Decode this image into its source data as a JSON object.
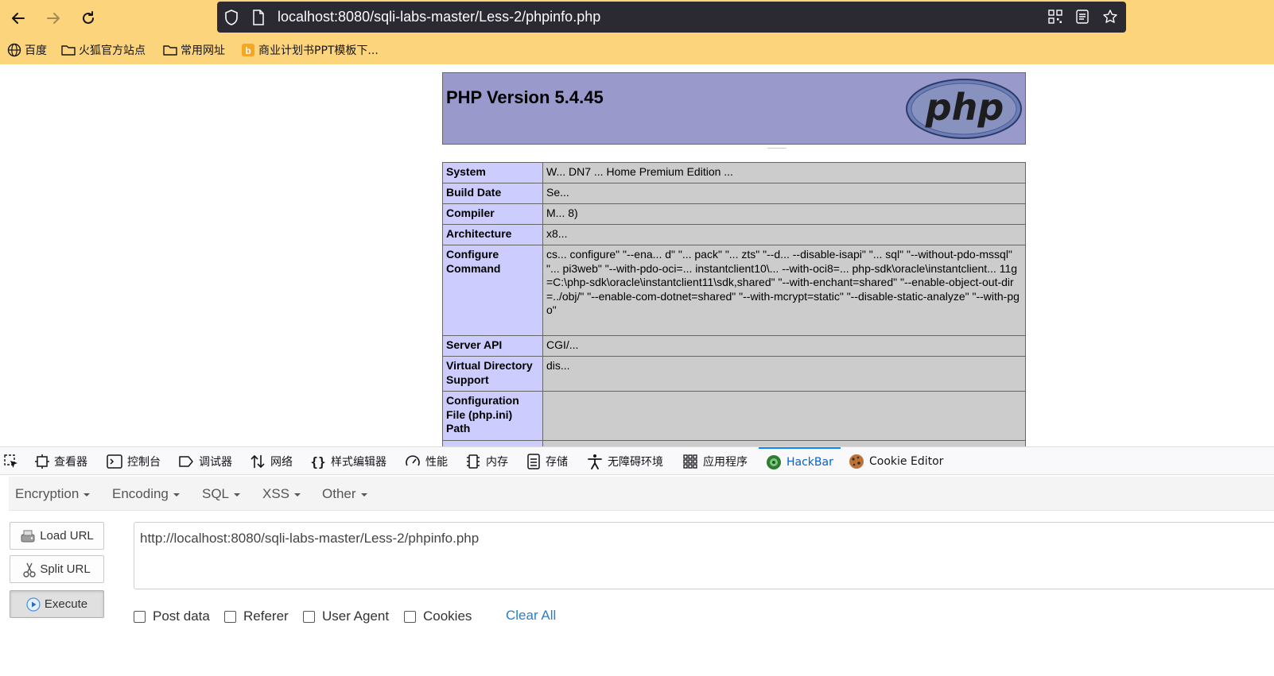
{
  "browser": {
    "url": "localhost:8080/sqli-labs-master/Less-2/phpinfo.php",
    "bookmarks": [
      {
        "label": "百度",
        "icon": "globe-icon"
      },
      {
        "label": "火狐官方站点",
        "icon": "folder-icon"
      },
      {
        "label": "常用网址",
        "icon": "folder-icon"
      },
      {
        "label": "商业计划书PPT模板下...",
        "icon": "bookmark-favicon"
      }
    ]
  },
  "phpinfo": {
    "title": "PHP Version 5.4.45",
    "logo_text": "php",
    "rows": [
      {
        "key": "System",
        "value": "W... DN7 ... Home Premium Edition ..."
      },
      {
        "key": "Build Date",
        "value": "Se..."
      },
      {
        "key": "Compiler",
        "value": "M... 8)"
      },
      {
        "key": "Architecture",
        "value": "x8..."
      },
      {
        "key": "Configure Command",
        "value": "cs... configure\" \"--ena... d\" \"... pack\" \"... zts\" \"--d... --disable-isapi\" \"... sql\" \"--without-pdo-mssql\" \"... pi3web\" \"--with-pdo-oci=... instantclient10\\... --with-oci8=... php-sdk\\oracle\\instantclient... 11g=C:\\php-sdk\\oracle\\instantclient11\\sdk,shared\" \"--with-enchant=shared\" \"--enable-object-out-dir=../obj/\" \"--enable-com-dotnet=shared\" \"--with-mcrypt=static\" \"--disable-static-analyze\" \"--with-pgo\""
      },
      {
        "key": "Server API",
        "value": "CGI/..."
      },
      {
        "key": "Virtual Directory Support",
        "value": "dis..."
      },
      {
        "key": "Configuration File (php.ini) Path",
        "value": ""
      },
      {
        "key": "",
        "value": ""
      }
    ]
  },
  "devtools": {
    "tabs": [
      {
        "label": "",
        "icon": "element-picker-icon"
      },
      {
        "label": "查看器",
        "icon": "inspector-icon"
      },
      {
        "label": "控制台",
        "icon": "console-icon"
      },
      {
        "label": "调试器",
        "icon": "debugger-icon"
      },
      {
        "label": "网络",
        "icon": "network-icon"
      },
      {
        "label": "样式编辑器",
        "icon": "style-editor-icon"
      },
      {
        "label": "性能",
        "icon": "performance-icon"
      },
      {
        "label": "内存",
        "icon": "memory-icon"
      },
      {
        "label": "存储",
        "icon": "storage-icon"
      },
      {
        "label": "无障碍环境",
        "icon": "accessibility-icon"
      },
      {
        "label": "应用程序",
        "icon": "application-icon"
      },
      {
        "label": "HackBar",
        "icon": "hackbar-icon",
        "active": true
      },
      {
        "label": "Cookie Editor",
        "icon": "cookie-icon"
      }
    ]
  },
  "hackbar": {
    "menus": [
      "Encryption",
      "Encoding",
      "SQL",
      "XSS",
      "Other"
    ],
    "load_url": "Load URL",
    "split_url": "Split URL",
    "execute": "Execute",
    "url_value": "http://localhost:8080/sqli-labs-master/Less-2/phpinfo.php",
    "options": [
      "Post data",
      "Referer",
      "User Agent",
      "Cookies"
    ],
    "clear_all": "Clear All"
  },
  "colors": {
    "toolbar_bg": "#fcd47c",
    "urlbar_bg": "#2b2a33",
    "php_header": "#9999cc",
    "php_key_cell": "#ccccff",
    "php_value_cell": "#cccccc",
    "active_tab": "#0060df",
    "link": "#2a7dc9"
  }
}
